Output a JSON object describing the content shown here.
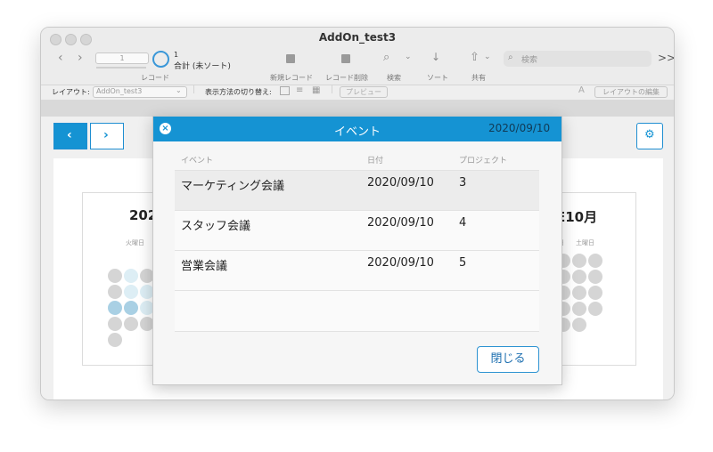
{
  "window": {
    "title": "AddOn_test3"
  },
  "toolbar": {
    "record_input": "1",
    "record_number": "1",
    "record_status": "合計 (未ソート)",
    "record_label": "レコード",
    "new_record": "新規レコード",
    "delete_record": "レコード削除",
    "find": "検索",
    "sort": "ソート",
    "share": "共有",
    "search_placeholder": "検索",
    "overflow": ">>"
  },
  "layoutbar": {
    "layout_label": "レイアウト:",
    "layout_value": "AddOn_test3",
    "view_switch_label": "表示方法の切り替え:",
    "preview": "プレビュー",
    "edit_layout": "レイアウトの編集"
  },
  "calendar": {
    "left_month": "202",
    "left_weekday": "火曜日",
    "right_month": "E10月",
    "right_weekday_1": "日",
    "right_weekday_2": "土曜日"
  },
  "modal": {
    "title": "イベント",
    "date": "2020/09/10",
    "columns": {
      "event": "イベント",
      "date": "日付",
      "project": "プロジェクト"
    },
    "rows": [
      {
        "event": "マーケティング会議",
        "date": "2020/09/10",
        "project": "3"
      },
      {
        "event": "スタッフ会議",
        "date": "2020/09/10",
        "project": "4"
      },
      {
        "event": "営業会議",
        "date": "2020/09/10",
        "project": "5"
      }
    ],
    "close_label": "閉じる"
  },
  "colors": {
    "accent": "#1593d3",
    "selected_row": "#ececec",
    "dot": "#d5d5d5",
    "dot_light": "#ddeef5",
    "dot_mid": "#a9d0e4"
  }
}
